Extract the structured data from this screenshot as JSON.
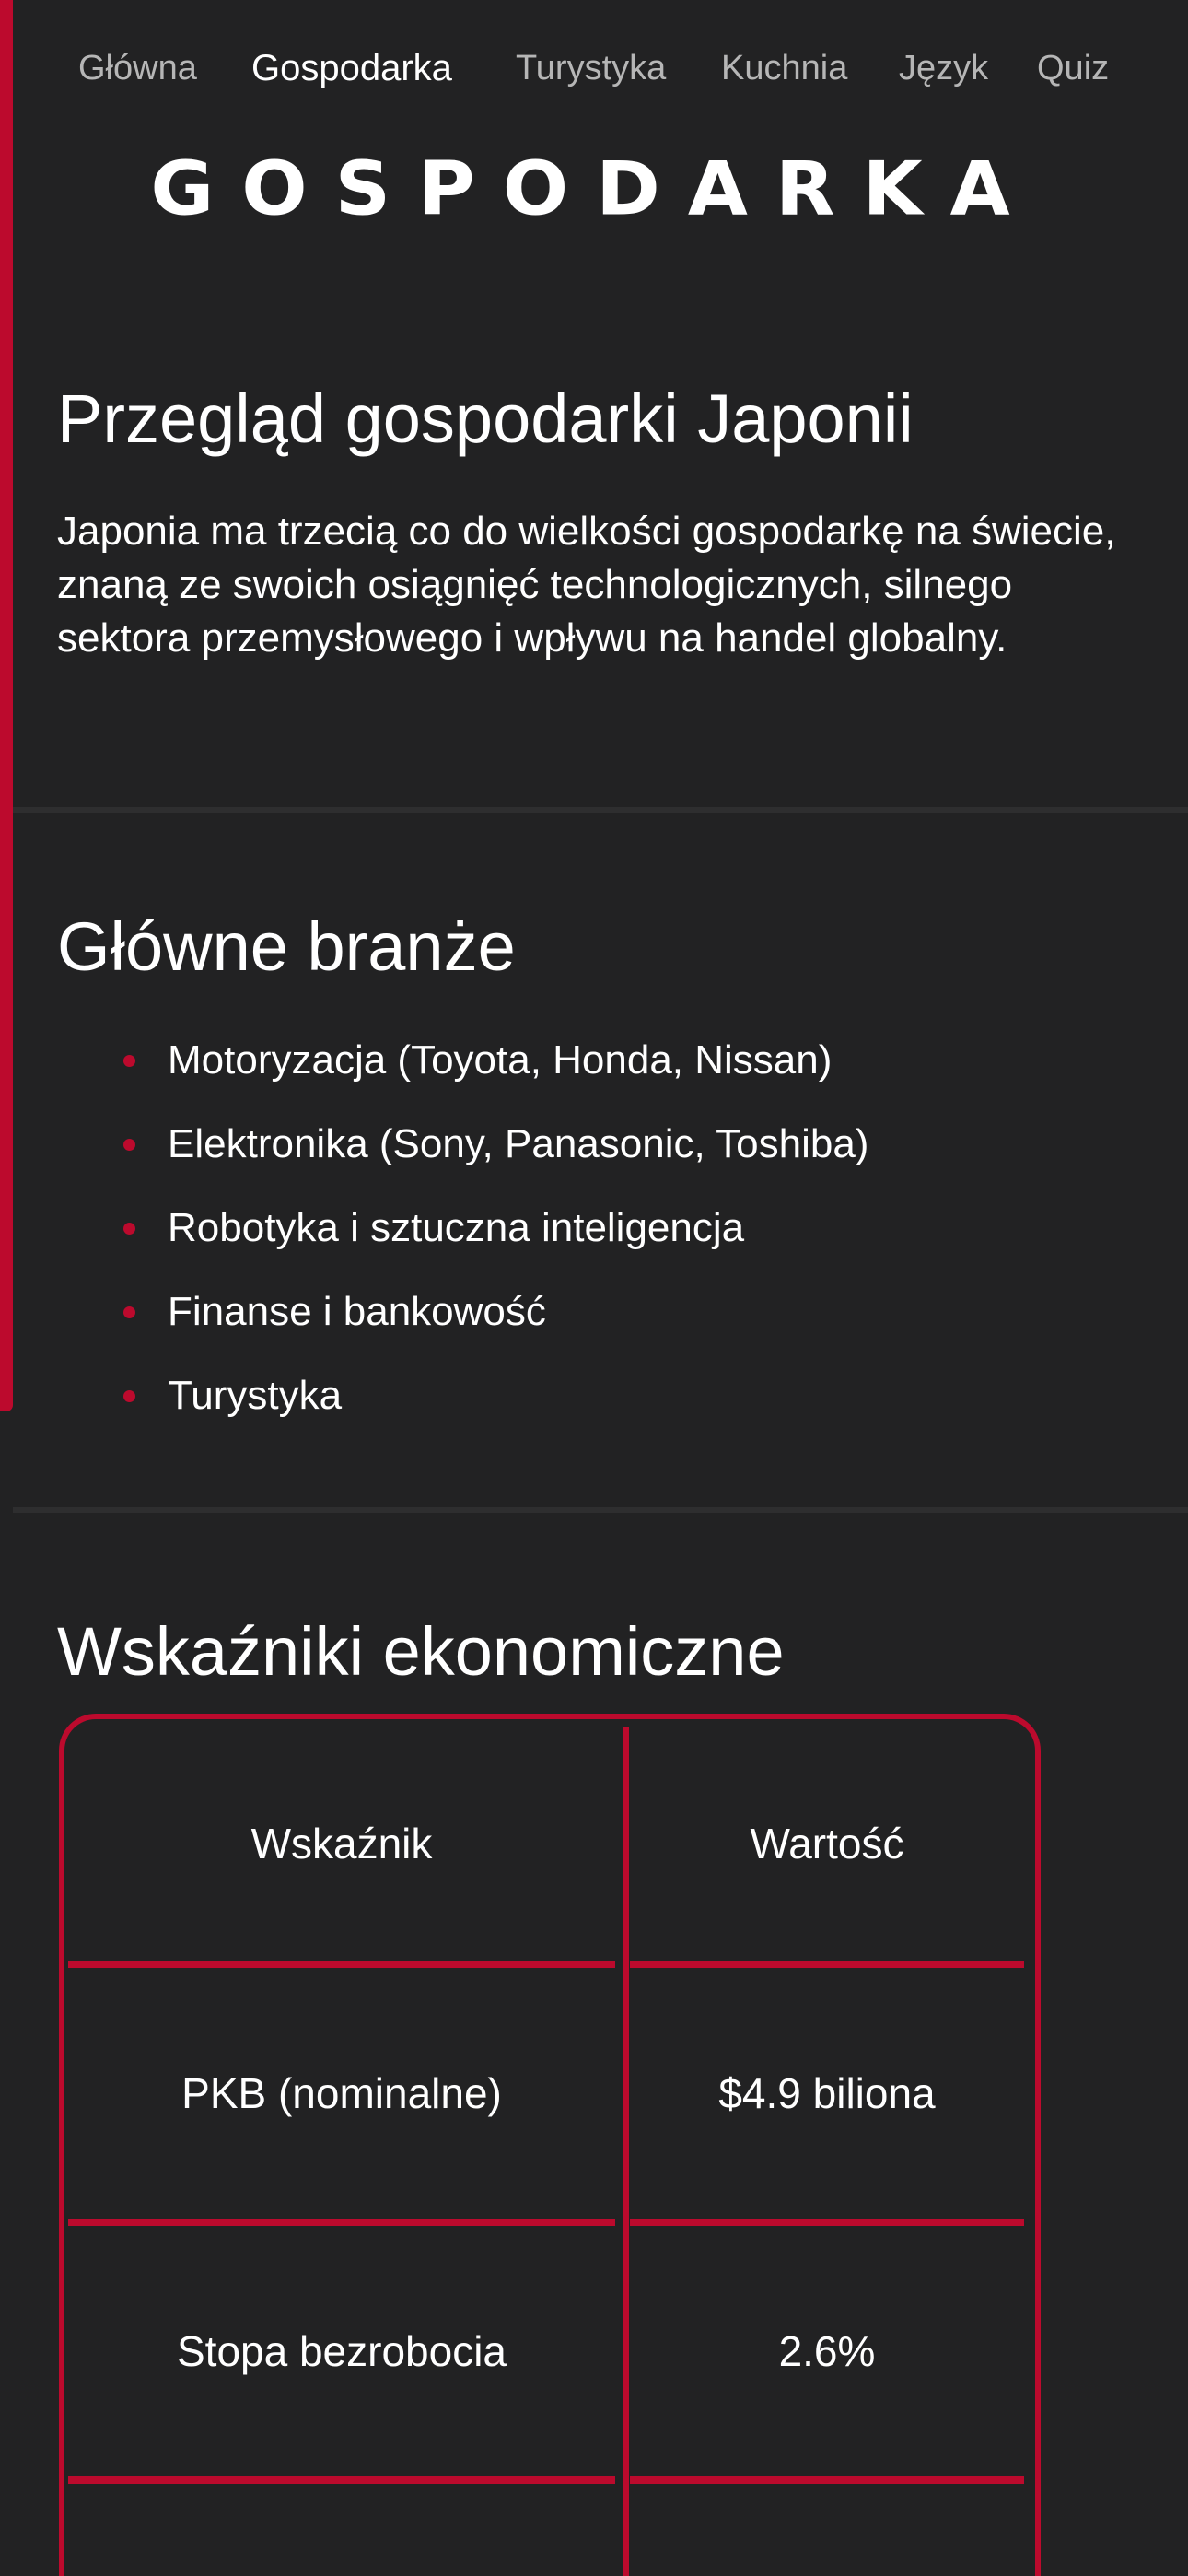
{
  "nav": {
    "items": [
      {
        "label": "Główna"
      },
      {
        "label": "Gospodarka"
      },
      {
        "label": "Turystyka"
      },
      {
        "label": "Kuchnia"
      },
      {
        "label": "Język"
      },
      {
        "label": "Quiz"
      }
    ],
    "active": "Gospodarka"
  },
  "logo": {
    "text": "GOSPODARKA"
  },
  "overview": {
    "title": "Przegląd gospodarki Japonii",
    "text": "Japonia ma trzecią co do wielkości gospodarkę na świecie, znaną ze swoich osiągnięć technologicznych, silnego sektora przemysłowego i wpływu na handel globalny."
  },
  "industries": {
    "title": "Główne branże",
    "items": [
      "Motoryzacja (Toyota, Honda, Nissan)",
      "Elektronika (Sony, Panasonic, Toshiba)",
      "Robotyka i sztuczna inteligencja",
      "Finanse i bankowość",
      "Turystyka"
    ]
  },
  "indicators": {
    "title": "Wskaźniki ekonomiczne",
    "headers": [
      "Wskaźnik",
      "Wartość"
    ],
    "rows": [
      [
        "PKB (nominalne)",
        "$4.9 biliona"
      ],
      [
        "Stopa bezrobocia",
        "2.6%"
      ]
    ]
  },
  "colors": {
    "accent": "#bc0a2d",
    "background": "#222223",
    "nav_inactive": "#b6b6b6",
    "text": "#ffffff"
  }
}
